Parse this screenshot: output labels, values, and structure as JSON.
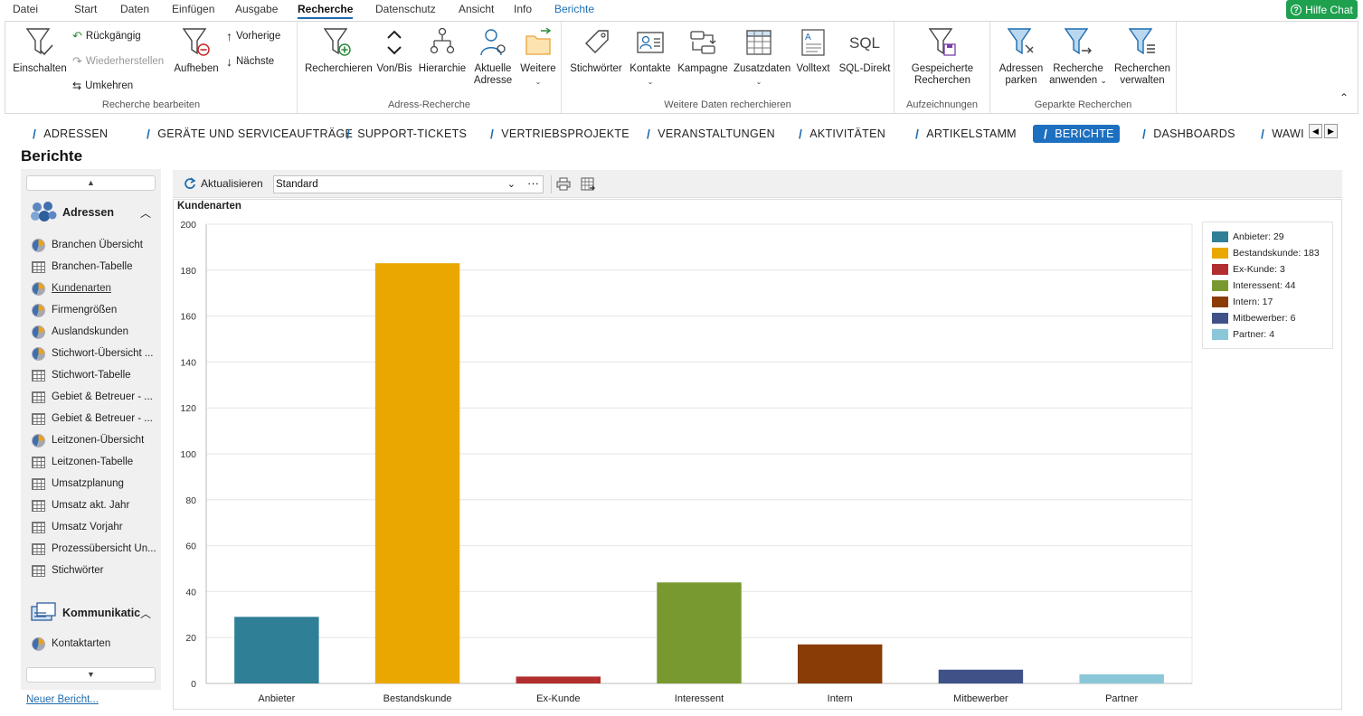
{
  "menu": {
    "items": [
      "Datei",
      "Start",
      "Daten",
      "Einfügen",
      "Ausgabe",
      "Recherche",
      "Datenschutz",
      "Ansicht",
      "Info",
      "Berichte"
    ],
    "active": "Recherche",
    "chat_label": "Hilfe Chat"
  },
  "ribbon": {
    "groups": {
      "recherche_bearbeiten": "Recherche bearbeiten",
      "adress_recherche": "Adress-Recherche",
      "weitere_daten": "Weitere Daten recherchieren",
      "aufzeichnungen": "Aufzeichnungen",
      "geparkte": "Geparkte Recherchen"
    },
    "buttons": {
      "einschalten": "Einschalten",
      "rueckgaengig": "Rückgängig",
      "wiederherstellen": "Wiederherstellen",
      "umkehren": "Umkehren",
      "aufheben": "Aufheben",
      "vorherige": "Vorherige",
      "naechste": "Nächste",
      "recherchieren": "Recherchieren",
      "vonbis": "Von/Bis",
      "hierarchie": "Hierarchie",
      "aktuelle_adresse_1": "Aktuelle",
      "aktuelle_adresse_2": "Adresse",
      "weitere": "Weitere",
      "stichwoerter": "Stichwörter",
      "kontakte": "Kontakte",
      "kampagne": "Kampagne",
      "zusatzdaten": "Zusatzdaten",
      "volltext": "Volltext",
      "sql_direkt": "SQL-Direkt",
      "sql_icon_text": "SQL",
      "gespeicherte_1": "Gespeicherte",
      "gespeicherte_2": "Recherchen",
      "adressen_parken_1": "Adressen",
      "adressen_parken_2": "parken",
      "recherche_anwenden_1": "Recherche",
      "recherche_anwenden_2": "anwenden",
      "recherchen_verwalten_1": "Recherchen",
      "recherchen_verwalten_2": "verwalten"
    }
  },
  "tabs": [
    "ADRESSEN",
    "GERÄTE UND SERVICEAUFTRÄGE",
    "SUPPORT-TICKETS",
    "VERTRIEBSPROJEKTE",
    "VERANSTALTUNGEN",
    "AKTIVITÄTEN",
    "ARTIKELSTAMM",
    "BERICHTE",
    "DASHBOARDS",
    "WAWI"
  ],
  "active_tab": "BERICHTE",
  "page_title": "Berichte",
  "sidebar": {
    "section1": "Adressen",
    "items": [
      {
        "label": "Branchen Übersicht",
        "icon": "pie-chart-icon"
      },
      {
        "label": "Branchen-Tabelle",
        "icon": "table-icon"
      },
      {
        "label": "Kundenarten",
        "icon": "pie-chart-icon"
      },
      {
        "label": "Firmengrößen",
        "icon": "pie-chart-icon"
      },
      {
        "label": "Auslandskunden",
        "icon": "pie-chart-icon"
      },
      {
        "label": "Stichwort-Übersicht ...",
        "icon": "pie-chart-icon"
      },
      {
        "label": "Stichwort-Tabelle",
        "icon": "table-icon"
      },
      {
        "label": "Gebiet & Betreuer - ...",
        "icon": "table-sum-icon"
      },
      {
        "label": "Gebiet & Betreuer - ...",
        "icon": "table-icon"
      },
      {
        "label": "Leitzonen-Übersicht",
        "icon": "pie-chart-icon"
      },
      {
        "label": "Leitzonen-Tabelle",
        "icon": "table-icon"
      },
      {
        "label": "Umsatzplanung",
        "icon": "table-icon"
      },
      {
        "label": "Umsatz akt. Jahr",
        "icon": "table-icon"
      },
      {
        "label": "Umsatz Vorjahr",
        "icon": "table-icon"
      },
      {
        "label": "Prozessübersicht Un...",
        "icon": "table-icon"
      },
      {
        "label": "Stichwörter",
        "icon": "table-icon"
      }
    ],
    "section2": "Kommunikatic",
    "items2": [
      {
        "label": "Kontaktarten",
        "icon": "pie-chart-icon"
      }
    ],
    "new_report": "Neuer Bericht..."
  },
  "toolbar": {
    "refresh_label": "Aktualisieren",
    "view_value": "Standard",
    "more": "···"
  },
  "chart_data": {
    "type": "bar",
    "title": "Kundenarten",
    "categories": [
      "Anbieter",
      "Bestandskunde",
      "Ex-Kunde",
      "Interessent",
      "Intern",
      "Mitbewerber",
      "Partner"
    ],
    "values": [
      29,
      183,
      3,
      44,
      17,
      6,
      4
    ],
    "colors": [
      "#2f7f96",
      "#eaa700",
      "#b32e2e",
      "#78992f",
      "#893c05",
      "#3e5287",
      "#8ac7d8"
    ],
    "legend": [
      "Anbieter: 29",
      "Bestandskunde: 183",
      "Ex-Kunde: 3",
      "Interessent: 44",
      "Intern: 17",
      "Mitbewerber: 6",
      "Partner: 4"
    ],
    "ylim": [
      0,
      200
    ],
    "yticks": [
      0,
      20,
      40,
      60,
      80,
      100,
      120,
      140,
      160,
      180,
      200
    ],
    "grid": true,
    "legend_position": "top-right"
  }
}
